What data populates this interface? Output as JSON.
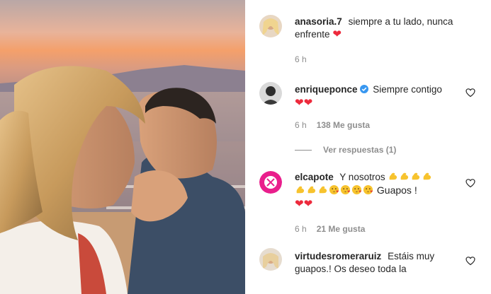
{
  "comments": [
    {
      "username": "anasoria.7",
      "text": "siempre a tu lado, nunca enfrente",
      "emoji_icons": [
        "red-heart-icon"
      ],
      "time": "6 h",
      "likes": "",
      "replies": ""
    },
    {
      "username": "enriqueponce",
      "verified": true,
      "text": "Siempre contigo",
      "emoji_icons": [
        "red-heart-icon",
        "red-heart-icon"
      ],
      "time": "6 h",
      "likes": "138 Me gusta",
      "replies": "Ver respuestas (1)"
    },
    {
      "username": "elcapote",
      "text": "Y nosotros",
      "text_after": "Guapos !",
      "emoji_icons": [
        "flexed-biceps-icon",
        "flexed-biceps-icon",
        "flexed-biceps-icon",
        "flexed-biceps-icon",
        "flexed-biceps-icon",
        "flexed-biceps-icon",
        "flexed-biceps-icon",
        "face-blowing-kiss-icon",
        "face-blowing-kiss-icon",
        "face-blowing-kiss-icon",
        "face-blowing-kiss-icon",
        "red-heart-icon",
        "red-heart-icon"
      ],
      "time": "6 h",
      "likes": "21 Me gusta",
      "replies": ""
    },
    {
      "username": "virtudesromeraruiz",
      "text": "Estáis muy guapos.! Os deseo toda la",
      "time": "",
      "likes": "",
      "replies": ""
    }
  ],
  "colors": {
    "heart": "#ed2a3c",
    "verified": "#3897f0",
    "meta": "#8e8e8e",
    "emoji_yellow": "#f7c32e"
  },
  "icons": {
    "like": "heart-outline-icon",
    "verified": "verified-badge-icon"
  }
}
